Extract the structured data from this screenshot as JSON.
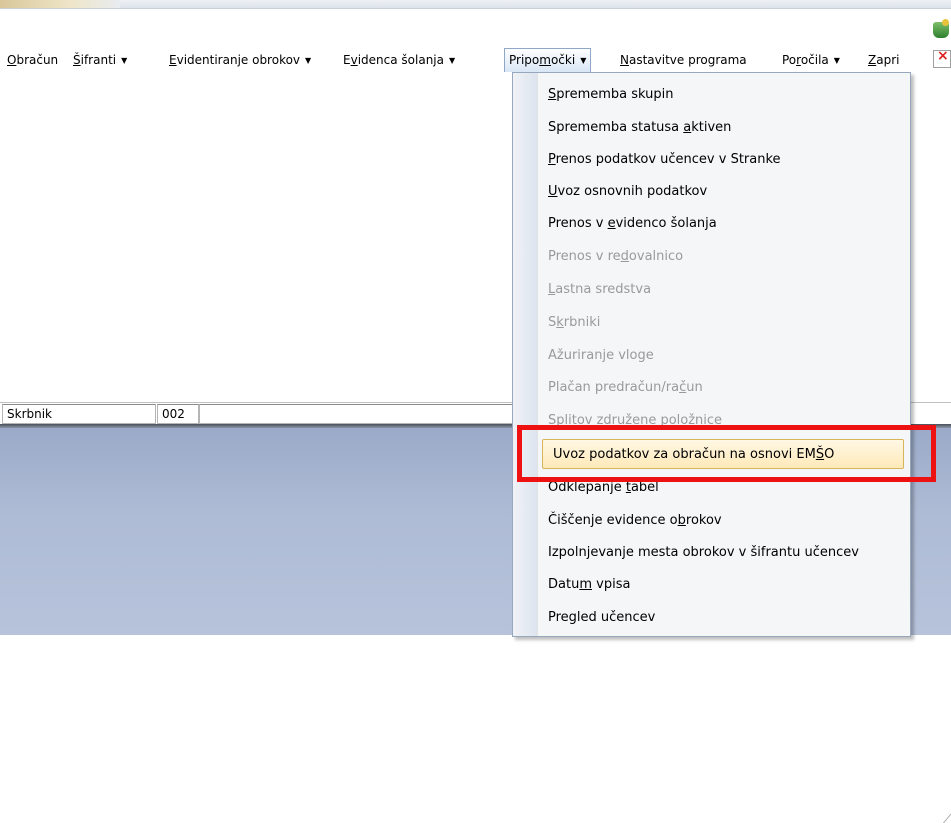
{
  "menubar": {
    "items": [
      {
        "pre": "",
        "u": "O",
        "post": "bračun",
        "arrow": false
      },
      {
        "pre": "",
        "u": "Š",
        "post": "ifranti",
        "arrow": true
      },
      {
        "pre": "",
        "u": "E",
        "post": "videntiranje obrokov",
        "arrow": true
      },
      {
        "pre": "E",
        "u": "v",
        "post": "idenca šolanja",
        "arrow": true
      },
      {
        "pre": "Pripo",
        "u": "m",
        "post": "očki",
        "arrow": true
      },
      {
        "pre": "",
        "u": "N",
        "post": "astavitve programa",
        "arrow": false
      },
      {
        "pre": "Po",
        "u": "r",
        "post": "očila",
        "arrow": true
      },
      {
        "pre": "",
        "u": "Z",
        "post": "apri",
        "arrow": false
      }
    ],
    "arrow_glyph": "▼"
  },
  "toolbar_icons": [
    "database-icon",
    "close-document-icon"
  ],
  "status": {
    "label": "Skrbnik",
    "code": "002",
    "field3": ""
  },
  "dropdown": {
    "items": [
      {
        "pre": "",
        "u": "S",
        "post": "prememba skupin",
        "enabled": true
      },
      {
        "pre": "Sprememba statusa ",
        "u": "a",
        "post": "ktiven",
        "enabled": true
      },
      {
        "pre": "",
        "u": "P",
        "post": "renos podatkov učencev v Stranke",
        "enabled": true
      },
      {
        "pre": "",
        "u": "U",
        "post": "voz osnovnih podatkov",
        "enabled": true
      },
      {
        "pre": "Prenos v ",
        "u": "e",
        "post": "videnco šolanja",
        "enabled": true
      },
      {
        "pre": "Prenos v re",
        "u": "d",
        "post": "ovalnico",
        "enabled": false
      },
      {
        "pre": "",
        "u": "L",
        "post": "astna sredstva",
        "enabled": false
      },
      {
        "pre": "S",
        "u": "k",
        "post": "rbniki",
        "enabled": false
      },
      {
        "pre": "Ažuriranje vloge",
        "u": "",
        "post": "",
        "enabled": false
      },
      {
        "pre": "Plačan predračun/ra",
        "u": "č",
        "post": "un",
        "enabled": false
      },
      {
        "pre": "Splitov združene položnice",
        "u": "",
        "post": "",
        "enabled": false
      },
      {
        "pre": "Uvoz podatkov za obračun na osnovi EM",
        "u": "Š",
        "post": "O",
        "enabled": true,
        "highlighted": true
      },
      {
        "pre": "Odklepanje ",
        "u": "t",
        "post": "abel",
        "enabled": true
      },
      {
        "pre": "Čiščenje evidence o",
        "u": "b",
        "post": "rokov",
        "enabled": true
      },
      {
        "pre": "Izpolnjevanje mesta obrokov v šifrantu učencev",
        "u": "",
        "post": "",
        "enabled": true
      },
      {
        "pre": "Datu",
        "u": "m",
        "post": " vpisa",
        "enabled": true
      },
      {
        "pre": "Pregled učencev",
        "u": "",
        "post": "",
        "enabled": true
      }
    ]
  }
}
